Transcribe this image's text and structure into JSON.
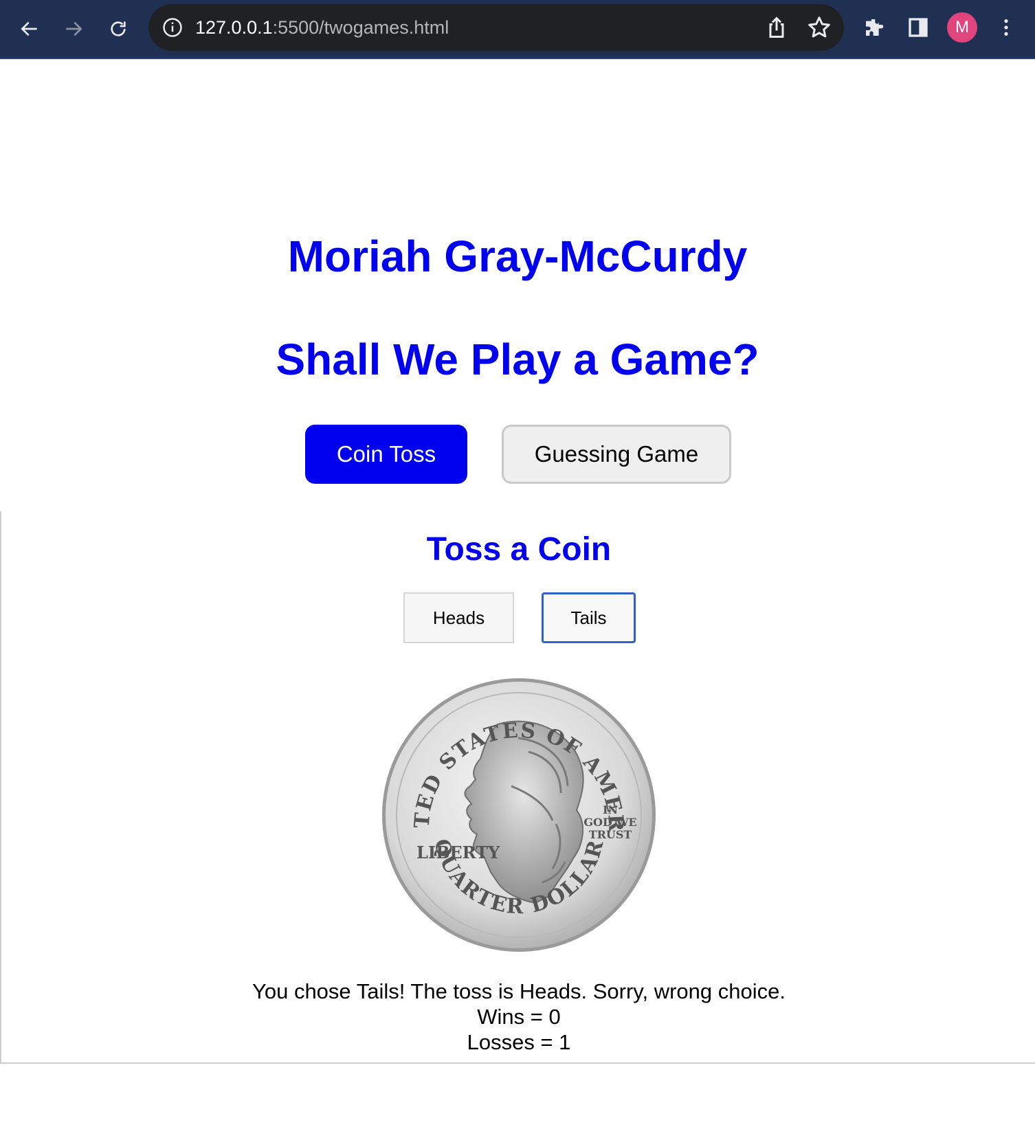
{
  "browser": {
    "url_host": "127.0.0.1",
    "url_rest": ":5500/twogames.html",
    "profile_initial": "M",
    "colors": {
      "toolbar": "#1f3052",
      "omnibox": "#202124",
      "avatar": "#e0457b"
    },
    "icons": [
      "back-arrow-icon",
      "forward-arrow-icon",
      "reload-icon",
      "info-icon",
      "share-icon",
      "star-icon",
      "extensions-icon",
      "side-panel-icon",
      "more-menu-icon"
    ]
  },
  "page": {
    "name_heading": "Moriah Gray-McCurdy",
    "prompt_heading": "Shall We Play a Game?",
    "game_buttons": {
      "coin_toss": "Coin Toss",
      "guessing_game": "Guessing Game"
    },
    "accent_color": "#0000ee"
  },
  "coin_toss": {
    "heading": "Toss a Coin",
    "heads_label": "Heads",
    "tails_label": "Tails",
    "coin": {
      "top_text": "UNITED STATES OF AMERICA",
      "motto": [
        "IN",
        "GOD WE",
        "TRUST"
      ],
      "liberty": "LIBERTY",
      "bottom_text": "QUARTER DOLLAR"
    },
    "result": {
      "message": "You chose Tails! The toss is Heads. Sorry, wrong choice.",
      "wins": "Wins = 0",
      "losses": "Losses = 1"
    }
  }
}
